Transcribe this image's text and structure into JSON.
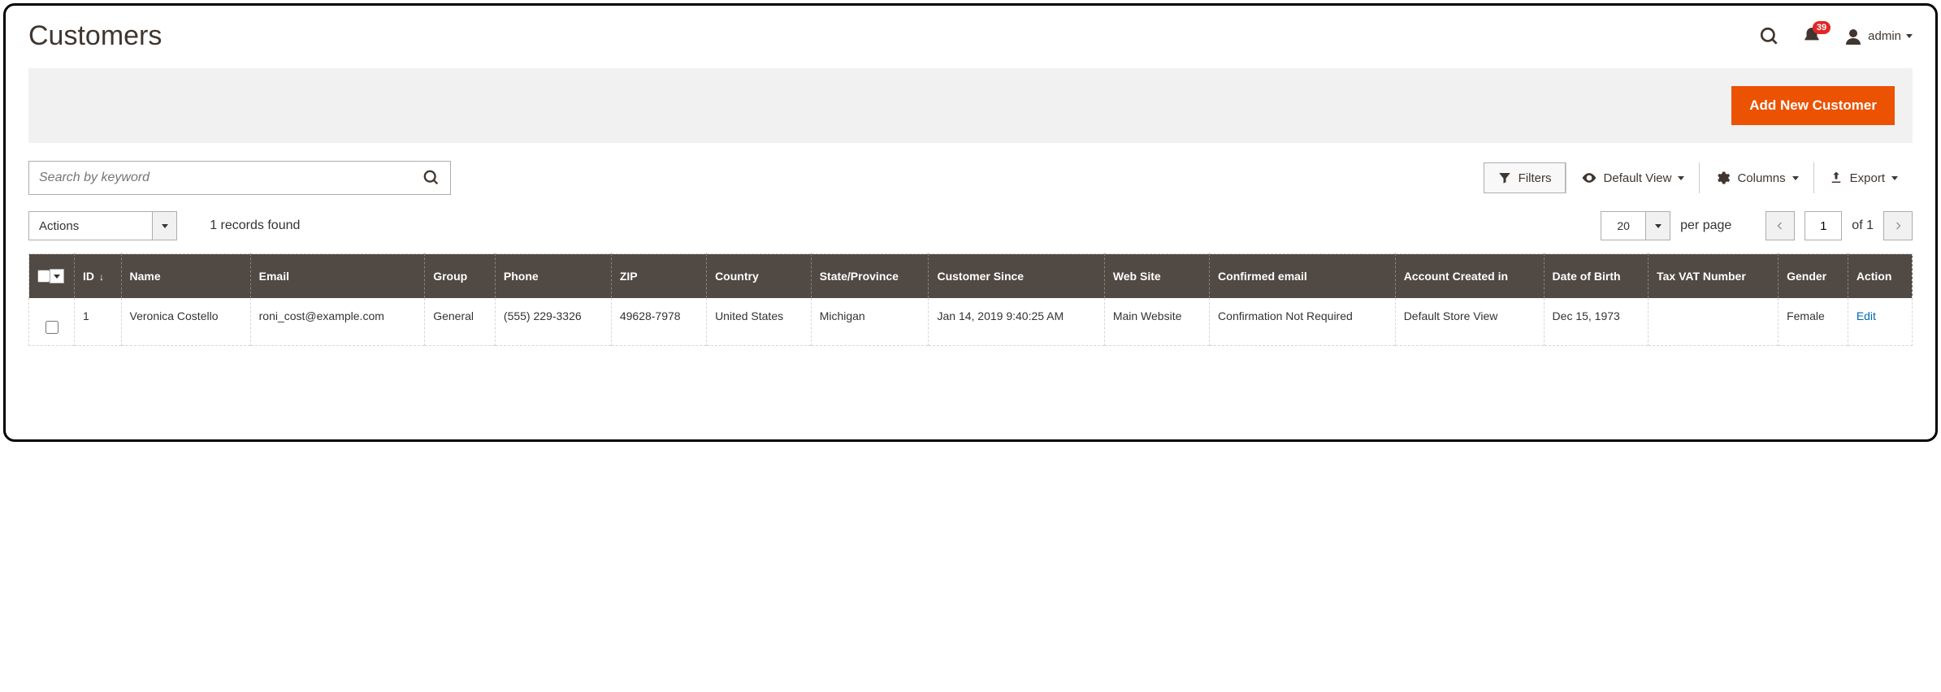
{
  "header": {
    "title": "Customers",
    "notification_count": "39",
    "user_name": "admin"
  },
  "toolbar": {
    "add_button": "Add New Customer"
  },
  "search": {
    "placeholder": "Search by keyword"
  },
  "controls": {
    "filters": "Filters",
    "default_view": "Default View",
    "columns": "Columns",
    "export": "Export"
  },
  "actions": {
    "label": "Actions",
    "records_found": "1 records found"
  },
  "pagination": {
    "per_page_value": "20",
    "per_page_label": "per page",
    "current": "1",
    "of_label": "of",
    "total": "1"
  },
  "columns": [
    "ID",
    "Name",
    "Email",
    "Group",
    "Phone",
    "ZIP",
    "Country",
    "State/Province",
    "Customer Since",
    "Web Site",
    "Confirmed email",
    "Account Created in",
    "Date of Birth",
    "Tax VAT Number",
    "Gender",
    "Action"
  ],
  "rows": [
    {
      "id": "1",
      "name": "Veronica Costello",
      "email": "roni_cost@example.com",
      "group": "General",
      "phone": "(555) 229-3326",
      "zip": "49628-7978",
      "country": "United States",
      "state": "Michigan",
      "since": "Jan 14, 2019 9:40:25 AM",
      "website": "Main Website",
      "confirmed": "Confirmation Not Required",
      "created_in": "Default Store View",
      "dob": "Dec 15, 1973",
      "tax_vat": "",
      "gender": "Female",
      "action": "Edit"
    }
  ]
}
